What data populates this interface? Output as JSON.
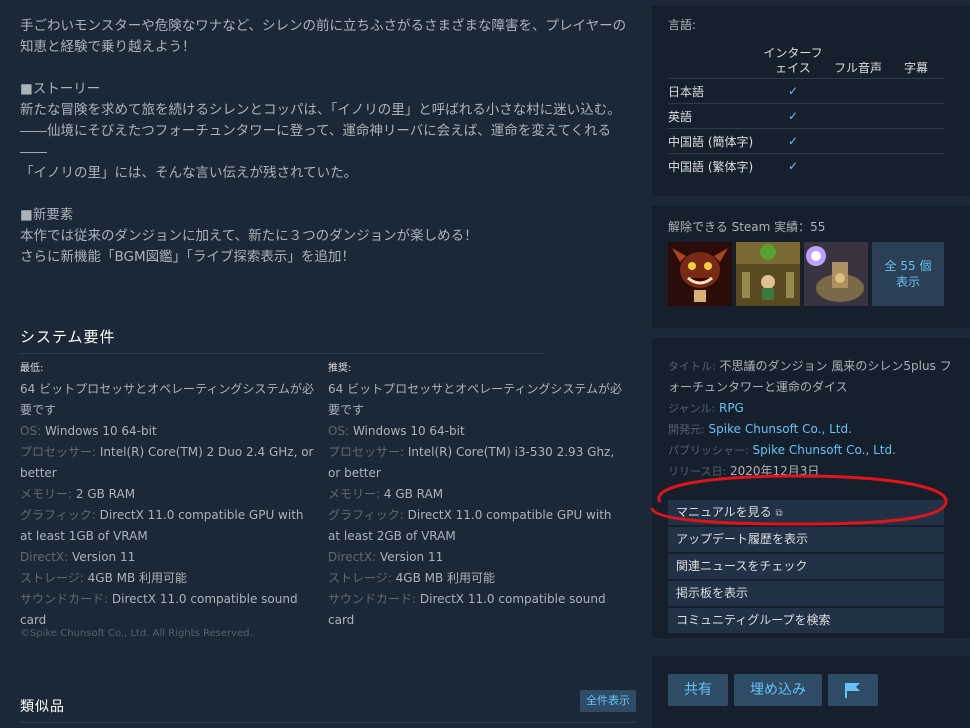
{
  "description": {
    "lines": [
      "手ごわいモンスターや危険なワナなど、シレンの前に立ちふさがるさまざまな障害を、プレイヤーの知恵と経験で乗り越えよう！",
      "",
      "■ストーリー",
      "新たな冒険を求めて旅を続けるシレンとコッパは、「イノリの里」と呼ばれる小さな村に迷い込む。",
      "――仙境にそびえたつフォーチュンタワーに登って、運命神リーバに会えば、運命を変えてくれる――",
      "「イノリの里」には、そんな言い伝えが残されていた。",
      "",
      "■新要素",
      "本作では従来のダンジョンに加えて、新たに３つのダンジョンが楽しめる！",
      "さらに新機能「BGM図鑑」「ライブ探索表示」を追加！"
    ]
  },
  "sysreq": {
    "title": "システム要件",
    "minimum": {
      "heading": "最低:",
      "items": [
        {
          "k": "",
          "v": "64 ビットプロセッサとオペレーティングシステムが必要です"
        },
        {
          "k": "OS:",
          "v": "Windows 10 64-bit"
        },
        {
          "k": "プロセッサー:",
          "v": "Intel(R) Core(TM) 2 Duo 2.4 GHz, or better"
        },
        {
          "k": "メモリー:",
          "v": "2 GB RAM"
        },
        {
          "k": "グラフィック:",
          "v": "DirectX 11.0 compatible GPU with at least 1GB of VRAM"
        },
        {
          "k": "DirectX:",
          "v": "Version 11"
        },
        {
          "k": "ストレージ:",
          "v": "4GB MB 利用可能"
        },
        {
          "k": "サウンドカード:",
          "v": "DirectX 11.0 compatible sound card"
        }
      ]
    },
    "recommended": {
      "heading": "推奨:",
      "items": [
        {
          "k": "",
          "v": "64 ビットプロセッサとオペレーティングシステムが必要です"
        },
        {
          "k": "OS:",
          "v": "Windows 10 64-bit"
        },
        {
          "k": "プロセッサー:",
          "v": "Intel(R) Core(TM) i3-530 2.93 Ghz, or better"
        },
        {
          "k": "メモリー:",
          "v": "4 GB RAM"
        },
        {
          "k": "グラフィック:",
          "v": "DirectX 11.0 compatible GPU with at least 2GB of VRAM"
        },
        {
          "k": "DirectX:",
          "v": "Version 11"
        },
        {
          "k": "ストレージ:",
          "v": "4GB MB 利用可能"
        },
        {
          "k": "サウンドカード:",
          "v": "DirectX 11.0 compatible sound card"
        }
      ]
    },
    "copyright": "©Spike Chunsoft Co., Ltd. All Rights Reserved."
  },
  "similar": {
    "title": "類似品",
    "show_all": "全件表示"
  },
  "languages": {
    "label": "言語:",
    "headers": [
      "インターフェイス",
      "フル音声",
      "字幕"
    ],
    "rows": [
      {
        "name": "日本語",
        "ui": "✓",
        "audio": "",
        "sub": ""
      },
      {
        "name": "英語",
        "ui": "✓",
        "audio": "",
        "sub": ""
      },
      {
        "name": "中国語 (簡体字)",
        "ui": "✓",
        "audio": "",
        "sub": ""
      },
      {
        "name": "中国語 (繁体字)",
        "ui": "✓",
        "audio": "",
        "sub": ""
      }
    ]
  },
  "achievements": {
    "label": "解除できる Steam 実績：55",
    "more_line1": "全 55 個",
    "more_line2": "表示"
  },
  "info": {
    "title_k": "タイトル:",
    "title_v": "不思議のダンジョン 風来のシレン5plus フォーチュンタワーと運命のダイス",
    "genre_k": "ジャンル:",
    "genre_v": "RPG",
    "dev_k": "開発元:",
    "dev_v": "Spike Chunsoft Co., Ltd.",
    "pub_k": "パブリッシャー:",
    "pub_v": "Spike Chunsoft Co., Ltd.",
    "release_k": "リリース日:",
    "release_v": "2020年12月3日"
  },
  "links": {
    "manual": "マニュアルを見る",
    "updates": "アップデート履歴を表示",
    "news": "関連ニュースをチェック",
    "discussions": "掲示板を表示",
    "groups": "コミュニティグループを検索"
  },
  "share": {
    "share": "共有",
    "embed": "埋め込み"
  },
  "colors": {
    "accent": "#67c1f5",
    "bg": "#1b2838",
    "panel": "#16202d",
    "annotation": "#e0141a"
  }
}
